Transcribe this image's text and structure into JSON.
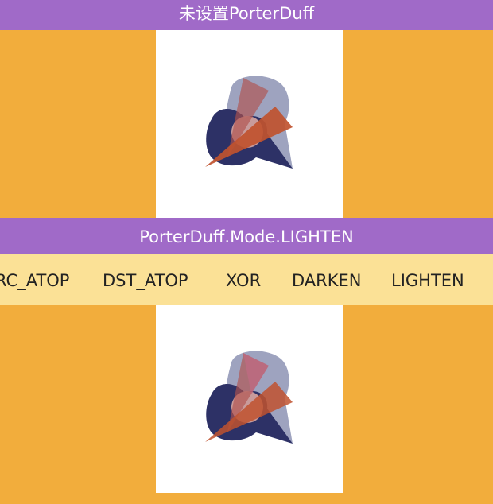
{
  "top_title": "未设置PorterDuff",
  "current_mode_title": "PorterDuff.Mode.LIGHTEN",
  "mode_tabs": [
    "RC_ATOP",
    "DST_ATOP",
    "XOR",
    "DARKEN",
    "LIGHTEN"
  ],
  "selected_mode": "LIGHTEN",
  "colors": {
    "background": "#f2ad3c",
    "title_bar": "#a06ac8",
    "tab_strip": "#fbe196",
    "canvas": "#ffffff",
    "dst_shape": "#2d3166",
    "src_triangle": "#c0522f",
    "light_blob": "#9ea3bf"
  }
}
